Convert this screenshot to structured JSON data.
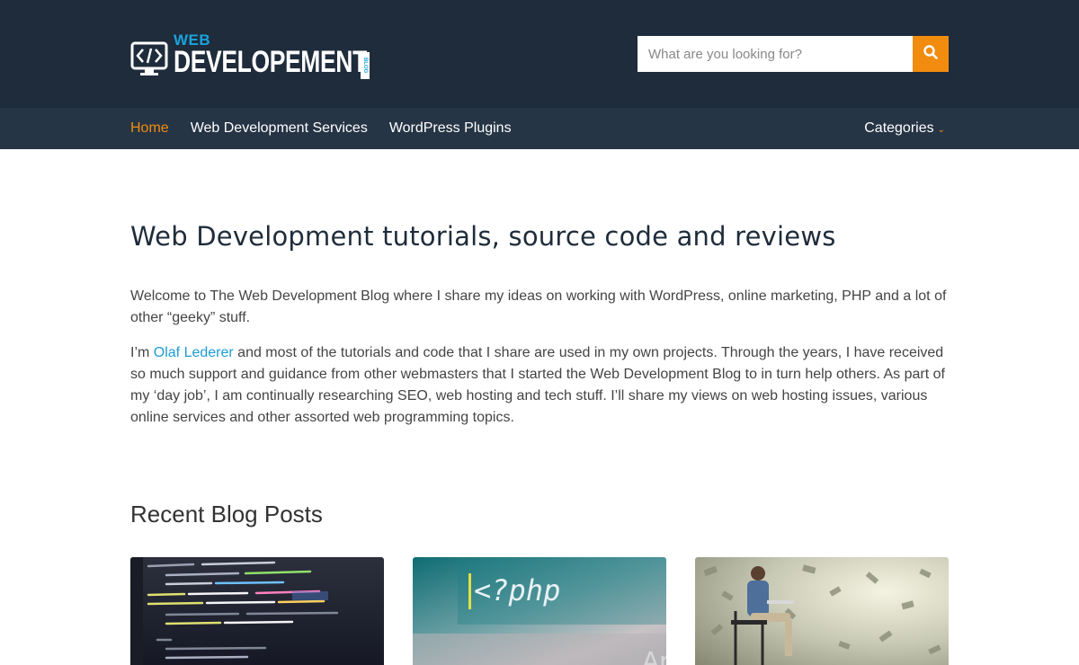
{
  "header": {
    "logo_small": "WEB",
    "logo_big": "DEVELOPEMENT",
    "logo_tag": "BLOG",
    "search_placeholder": "What are you looking for?",
    "search_icon": "search-icon",
    "accent_color": "#f28c0f",
    "brand_blue": "#1aa3dd"
  },
  "nav": {
    "items": [
      {
        "label": "Home",
        "active": true
      },
      {
        "label": "Web Development Services",
        "active": false
      },
      {
        "label": "WordPress Plugins",
        "active": false
      }
    ],
    "categories_label": "Categories",
    "categories_caret": "⌄"
  },
  "main": {
    "title": "Web Development tutorials, source code and reviews",
    "intro_p1": "Welcome to The Web Development Blog where I share my ideas on working with WordPress, online marketing, PHP and a lot of other “geeky” stuff.",
    "intro_p2_before": "I’m ",
    "intro_p2_link": "Olaf Lederer",
    "intro_p2_after": " and most of the tutorials and code that I share are used in my own projects. Through the years, I have received so much support and guidance from other webmasters that I started the Web Development Blog to in turn help others. As part of my ‘day job’, I am continually researching SEO, web hosting and tech stuff. I’ll share my views on web hosting issues, various online services and other assorted web programming topics.",
    "recent_title": "Recent Blog Posts"
  },
  "posts": [
    {
      "image": "code-editor-screenshot"
    },
    {
      "image": "php-tag-screenshot",
      "overlay_text": "<?php"
    },
    {
      "image": "man-laptop-money-photo"
    }
  ]
}
